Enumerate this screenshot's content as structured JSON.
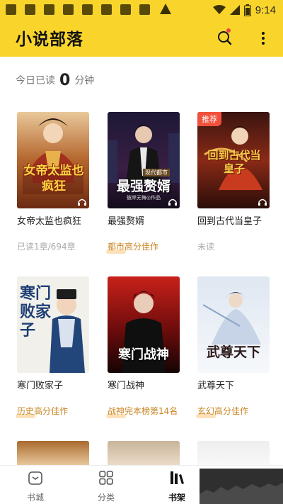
{
  "status_bar": {
    "time": "9:14"
  },
  "header": {
    "title": "小说部落"
  },
  "reading": {
    "prefix": "今日已读",
    "count": "0",
    "suffix": "分钟"
  },
  "books": [
    {
      "title": "女帝太监也疯狂",
      "sub": "已读1章/694章",
      "sub_type": "progress",
      "cover_text": "女帝太监也疯狂"
    },
    {
      "title": "最强赘婿",
      "sub": "都市高分佳作",
      "sub_type": "tag",
      "cover_text": "最强赘婿",
      "cover_small": "现代都市",
      "cover_author": "彼岸无悔◎作品"
    },
    {
      "title": "回到古代当皇子",
      "sub": "未读",
      "sub_type": "progress",
      "badge": "推荐",
      "cover_text": "回到古代当皇子"
    },
    {
      "title": "寒门败家子",
      "sub": "历史高分佳作",
      "sub_type": "tag",
      "cover_text": "寒门败家子"
    },
    {
      "title": "寒门战神",
      "sub": "战神完本榜第14名",
      "sub_type": "tag",
      "cover_text": "寒门战神"
    },
    {
      "title": "武尊天下",
      "sub": "玄幻高分佳作",
      "sub_type": "tag",
      "cover_text": "武尊天下"
    }
  ],
  "bottom_nav": [
    {
      "label": "书城",
      "icon": "store-icon",
      "active": false
    },
    {
      "label": "分类",
      "icon": "grid-icon",
      "active": false
    },
    {
      "label": "书架",
      "icon": "bookshelf-icon",
      "active": true
    }
  ],
  "colors": {
    "accent": "#f9d52c",
    "tag": "#c98522",
    "badge": "#f0503c"
  }
}
